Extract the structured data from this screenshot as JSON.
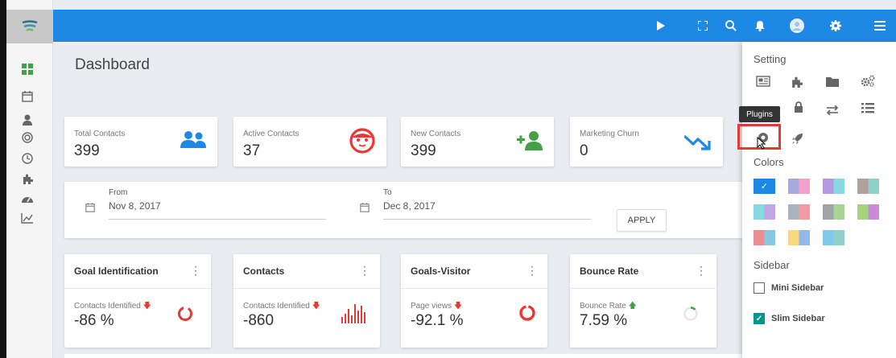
{
  "topbar": {
    "icons": [
      "play-icon",
      "fullscreen-icon",
      "search-icon",
      "bell-icon",
      "avatar",
      "gear-icon",
      "menu-icon"
    ]
  },
  "sidebar": {
    "icons": [
      "dashboard-icon",
      "calendar-icon",
      "user-icon",
      "target-icon",
      "clock-icon",
      "puzzle-icon",
      "speedometer-icon",
      "chart-line-icon"
    ]
  },
  "page": {
    "title": "Dashboard"
  },
  "stats": [
    {
      "label": "Total Contacts",
      "value": "399",
      "icon": "people-icon"
    },
    {
      "label": "Active Contacts",
      "value": "37",
      "icon": "face-icon"
    },
    {
      "label": "New Contacts",
      "value": "399",
      "icon": "add-person-icon"
    },
    {
      "label": "Marketing Churn",
      "value": "0",
      "icon": "trend-down-icon"
    }
  ],
  "dates": {
    "from_label": "From",
    "from_value": "Nov 8, 2017",
    "to_label": "To",
    "to_value": "Dec 8, 2017",
    "apply_label": "APPLY"
  },
  "widgets": [
    {
      "title": "Goal Identification",
      "label": "Contacts Identified",
      "trend": "down",
      "value": "-86 %",
      "graphic": "ring"
    },
    {
      "title": "Contacts",
      "label": "Contacts Identified",
      "trend": "down",
      "value": "-860",
      "graphic": "bars"
    },
    {
      "title": "Goals-Visitor",
      "label": "Page views",
      "trend": "down",
      "value": "-92.1 %",
      "graphic": "ring"
    },
    {
      "title": "Bounce Rate",
      "label": "Bounce Rate",
      "trend": "up",
      "value": "7.59 %",
      "graphic": "ring-partial"
    }
  ],
  "panel": {
    "setting_heading": "Setting",
    "tooltip": "Plugins",
    "colors_heading": "Colors",
    "sidebar_heading": "Sidebar",
    "mini_sidebar": "Mini Sidebar",
    "slim_sidebar": "Slim Sidebar",
    "mini_checked": false,
    "slim_checked": true
  },
  "colors": {
    "brand": "#1e88e5",
    "danger": "#e53935",
    "success": "#43a047",
    "teal": "#009688"
  }
}
